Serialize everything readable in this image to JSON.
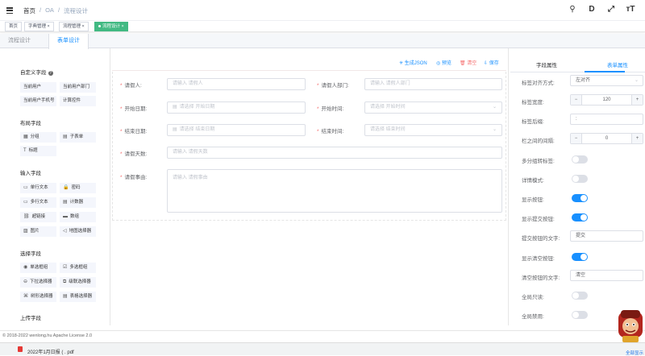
{
  "header": {
    "breadcrumbs": [
      "首页",
      "OA",
      "流程设计"
    ],
    "separator": "/",
    "tool_icons": [
      "search-icon",
      "document-icon",
      "fullscreen-icon",
      "font-size-icon"
    ],
    "tool_glyphs": [
      "⚲",
      "D",
      "⤢",
      "тT"
    ]
  },
  "tags_view": [
    {
      "label": "首页",
      "active": false
    },
    {
      "label": "字典管理 ×",
      "active": false
    },
    {
      "label": "流程管理 ×",
      "active": false
    },
    {
      "label": "流程设计 ×",
      "active": true
    }
  ],
  "tabs": [
    "流程设计",
    "表单设计"
  ],
  "left_panel": {
    "custom_title": "自定义字段",
    "custom_items": [
      "当前用户",
      "当前用户部门",
      "当前用户手机号",
      "计算控件"
    ],
    "layout_title": "布局字段",
    "layout_items": [
      {
        "icon": "▦",
        "label": "分组"
      },
      {
        "icon": "▤",
        "label": "子表单"
      },
      {
        "icon": "T",
        "label": "标题"
      }
    ],
    "input_title": "输入字段",
    "input_items": [
      {
        "icon": "▭",
        "label": "单行文本"
      },
      {
        "icon": "🔒",
        "label": "密码"
      },
      {
        "icon": "▭",
        "label": "多行文本"
      },
      {
        "icon": "▤",
        "label": "计数器"
      },
      {
        "icon": "⛓",
        "label": "超链接"
      },
      {
        "icon": "▬",
        "label": "数组"
      },
      {
        "icon": "▨",
        "label": "图片"
      },
      {
        "icon": "◁",
        "label": "地图选择器"
      }
    ],
    "select_title": "选择字段",
    "select_items": [
      {
        "icon": "◉",
        "label": "单选框组"
      },
      {
        "icon": "☑",
        "label": "多选框组"
      },
      {
        "icon": "⊖",
        "label": "下拉选择器"
      },
      {
        "icon": "⧉",
        "label": "级联选择器"
      },
      {
        "icon": "⌘",
        "label": "树形选择器"
      },
      {
        "icon": "▤",
        "label": "表格选择器"
      }
    ],
    "upload_title": "上传字段"
  },
  "toolbar": {
    "generate_json": "✳ 生成JSON",
    "preview": "◎ 预览",
    "clear": "🗑 清空",
    "save": "⇩ 保存"
  },
  "form": {
    "applicant_label": "请假人:",
    "applicant_placeholder": "请输入 请假人",
    "department_label": "请假人部门:",
    "department_placeholder": "请输入 请假人部门",
    "start_date_label": "开始日期:",
    "start_date_placeholder": "请选择 开始日期",
    "start_time_label": "开始时间:",
    "start_time_placeholder": "请选择 开始时间",
    "end_date_label": "结束日期:",
    "end_date_placeholder": "请选择 结束日期",
    "end_time_label": "结束时间:",
    "end_time_placeholder": "请选择 结束时间",
    "days_label": "请假天数:",
    "days_placeholder": "请输入 请假天数",
    "reason_label": "请假事由:",
    "reason_placeholder": "请输入 请假事由",
    "required_mark": "*"
  },
  "right_panel": {
    "tab_field": "字段属性",
    "tab_form": "表单属性",
    "label_align_label": "标签对齐方式:",
    "label_align_value": "左对齐",
    "label_width_label": "标签宽度:",
    "label_width_value": "120",
    "label_suffix_label": "标签后缀:",
    "label_suffix_value": ":",
    "gutter_label": "栏之间的间隔:",
    "gutter_value": "0",
    "multi_group_label": "多分组转标签:",
    "multi_group_on": false,
    "detail_label": "详情模式:",
    "detail_on": false,
    "show_button_label": "显示按钮:",
    "show_button_on": true,
    "show_submit_label": "显示提交按钮:",
    "show_submit_on": true,
    "submit_text_label": "提交按钮的文字:",
    "submit_text_value": "提交",
    "show_reset_label": "显示清空按钮:",
    "show_reset_on": true,
    "reset_text_label": "清空按钮的文字:",
    "reset_text_value": "清空",
    "readonly_label": "全局只读:",
    "readonly_on": false,
    "disabled_label": "全局禁用:",
    "disabled_on": false,
    "minus": "−",
    "plus": "+"
  },
  "footer": {
    "copyright": "© 2018-2022 wenlong.hu Apache License 2.0"
  },
  "download_bar": {
    "file": "2022年1月日报 ( . pdf",
    "right_link": "全部显示"
  },
  "colors": {
    "primary": "#1890ff",
    "active_tag": "#42b983",
    "danger": "#f56c6c"
  }
}
